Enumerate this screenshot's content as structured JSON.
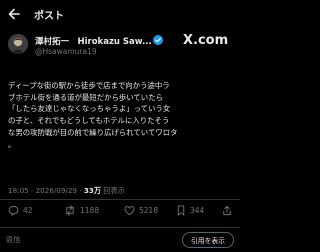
{
  "header": {
    "title": "ポスト"
  },
  "author": {
    "name": "澤村拓一　Hirokazu Saw...",
    "handle": "@Hsawamura19",
    "brand": "X.com"
  },
  "post": {
    "lines": [
      "ディープな街の駅から徒歩で店まで向かう途中ラ",
      "ブホテル街を通る道が最短だから歩いていたら",
      "「したら友達じゃなくなっちゃうよ」っていう女",
      "の子と、それでもどうしてもホテルに入りたそう",
      "な男の攻防戦が目の前で繰り広げられていてワロタ",
      "。"
    ],
    "time": "18:05 · 2026/09/29 · ",
    "views": "33万",
    "views_label": "回表示"
  },
  "actions": {
    "replies": "42",
    "reposts": "1188",
    "likes": "5218",
    "bookmarks": "344"
  },
  "reply_bar": {
    "placeholder": "返信",
    "quote_label": "引用を表示"
  },
  "colors": {
    "background": "#000000",
    "text": "#e7e9ea",
    "muted": "#71767b",
    "verified": "#1d9bf0"
  }
}
